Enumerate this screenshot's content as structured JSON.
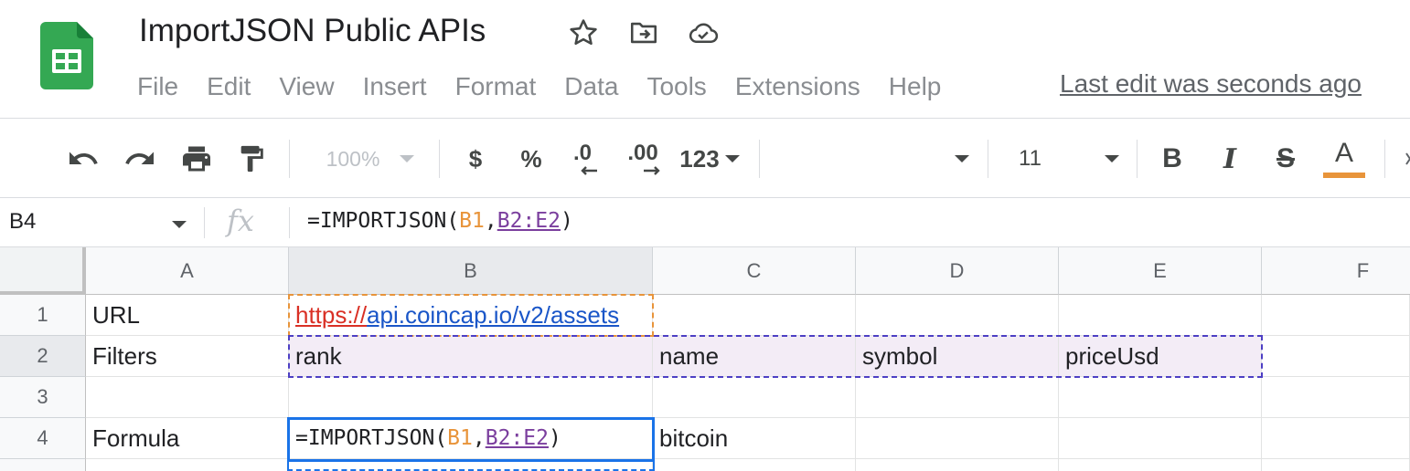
{
  "document": {
    "title": "ImportJSON Public APIs",
    "last_edit": "Last edit was seconds ago"
  },
  "title_icons": [
    "star-icon",
    "move-to-folder-icon",
    "cloud-saved-icon"
  ],
  "menu": [
    "File",
    "Edit",
    "View",
    "Insert",
    "Format",
    "Data",
    "Tools",
    "Extensions",
    "Help"
  ],
  "toolbar": {
    "zoom": "100%",
    "currency": "$",
    "percent": "%",
    "decrease_decimal": ".0",
    "increase_decimal": ".00",
    "more_formats": "123",
    "font_size": "11",
    "bold": "B",
    "italic": "I",
    "strike": "S",
    "text_color_letter": "A",
    "text_color_accent": "#e8943a"
  },
  "formula_bar": {
    "cell_ref": "B4",
    "fx": "fx",
    "formula_prefix": "=IMPORTJSON(",
    "ref1": "B1",
    "comma": ",",
    "ref2": "B2:E2",
    "formula_suffix": ")"
  },
  "grid": {
    "columns": [
      "A",
      "B",
      "C",
      "D",
      "E",
      "F"
    ],
    "rows": [
      "1",
      "2",
      "3",
      "4"
    ],
    "cells": {
      "A1": "URL",
      "B1_scheme": "https://",
      "B1_rest": "api.coincap.io/v2/assets",
      "A2": "Filters",
      "B2": "rank",
      "C2": "name",
      "D2": "symbol",
      "E2": "priceUsd",
      "A4": "Formula",
      "B4_prefix": "=IMPORTJSON(",
      "B4_ref1": "B1",
      "B4_comma": ",",
      "B4_ref2": "B2:E2",
      "B4_suffix": ")",
      "C4": "bitcoin"
    }
  }
}
